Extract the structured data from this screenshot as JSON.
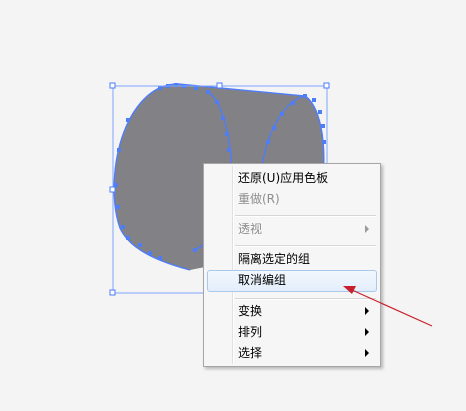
{
  "colors": {
    "shape_fill": "#828286",
    "selection_blue": "#4a7bff",
    "anchor_blue": "#4f7cf7",
    "menu_bg": "#f6f6f6",
    "hover_bg": "#e3eefb",
    "annotation_arrow": "#c8202a"
  },
  "context_menu": {
    "items": [
      {
        "label": "还原(U)应用色板",
        "disabled": false,
        "submenu": false
      },
      {
        "label": "重做(R)",
        "disabled": true,
        "submenu": false
      },
      {
        "label": "透视",
        "disabled": true,
        "submenu": true
      },
      {
        "label": "隔离选定的组",
        "disabled": false,
        "submenu": false
      },
      {
        "label": "取消编组",
        "disabled": false,
        "submenu": false,
        "highlighted": true
      },
      {
        "label": "变换",
        "disabled": false,
        "submenu": true
      },
      {
        "label": "排列",
        "disabled": false,
        "submenu": true
      },
      {
        "label": "选择",
        "disabled": false,
        "submenu": true
      }
    ]
  }
}
